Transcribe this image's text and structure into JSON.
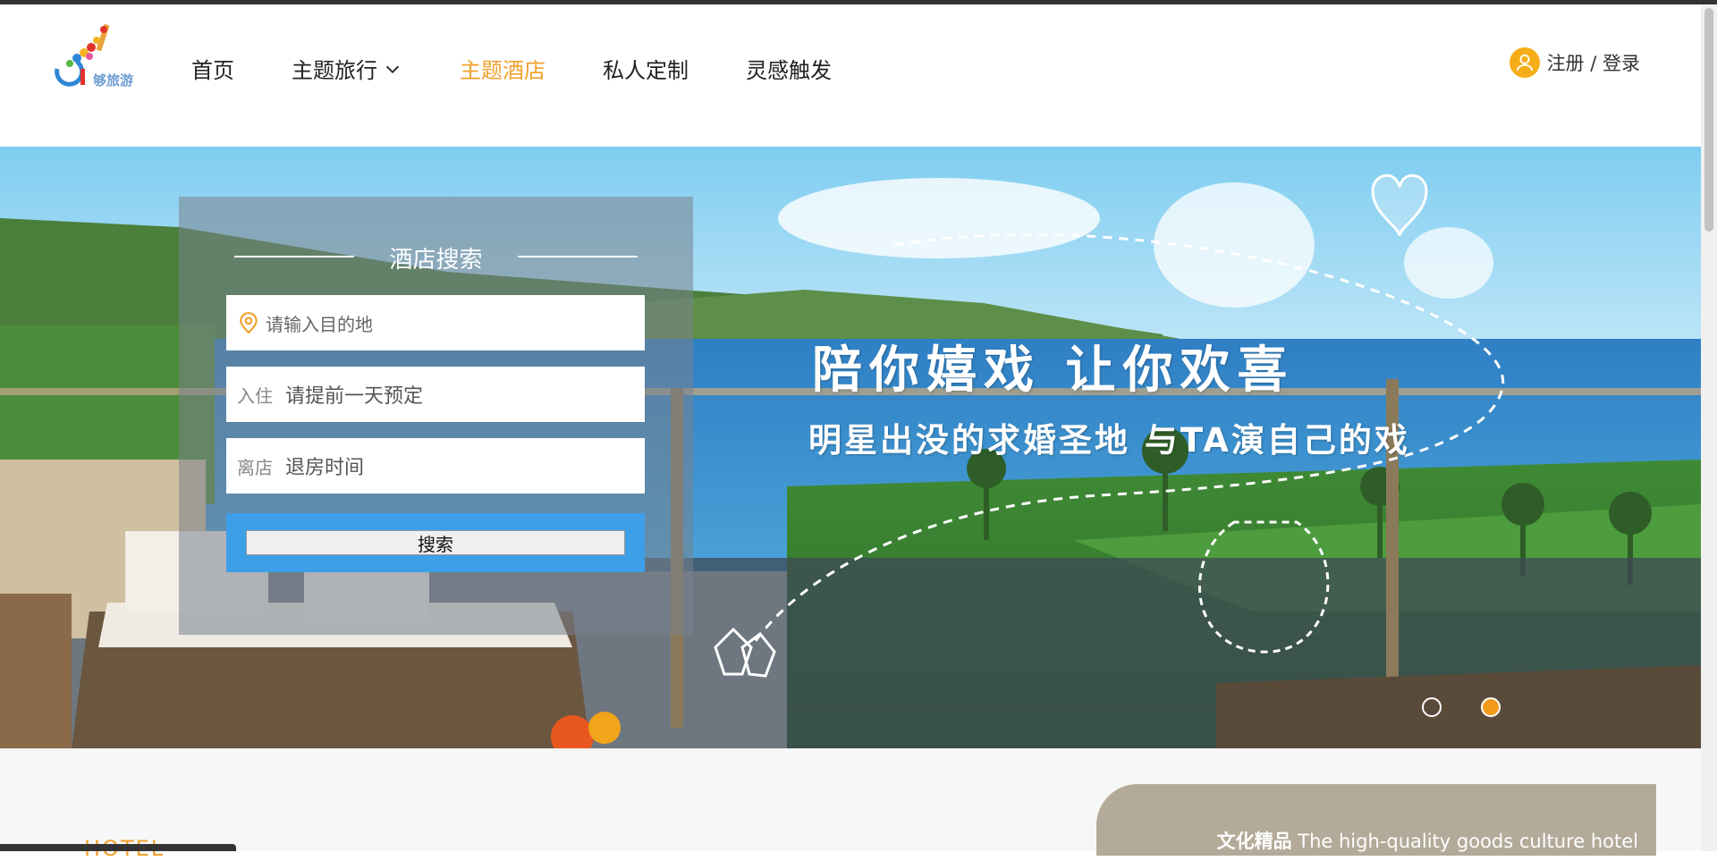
{
  "header": {
    "brand": "够旅游",
    "nav": [
      {
        "label": "首页"
      },
      {
        "label": "主题旅行"
      },
      {
        "label": "主题酒店"
      },
      {
        "label": "私人定制"
      },
      {
        "label": "灵感触发"
      }
    ],
    "active_nav": "主题酒店",
    "auth_label": "注册 / 登录"
  },
  "search": {
    "title": "酒店搜索",
    "destination_placeholder": "请输入目的地",
    "checkin_prefix": "入住",
    "checkin_placeholder": "请提前一天预定",
    "checkout_prefix": "离店",
    "checkout_placeholder": "退房时间",
    "button_label": "搜索"
  },
  "banner": {
    "slogan_main": "陪你嬉戏 让你欢喜",
    "slogan_sub": "明星出没的求婚圣地 与TA演自己的戏",
    "slides": 2,
    "active_slide": 2
  },
  "section": {
    "culture_bold": "文化精品",
    "culture_text": " The high-quality goods culture hotel",
    "hotel_label": "HOTEL"
  },
  "colors": {
    "accent": "#f0a12c",
    "search_blue": "#3d9fe8",
    "culture_bg": "#b3aa99"
  }
}
